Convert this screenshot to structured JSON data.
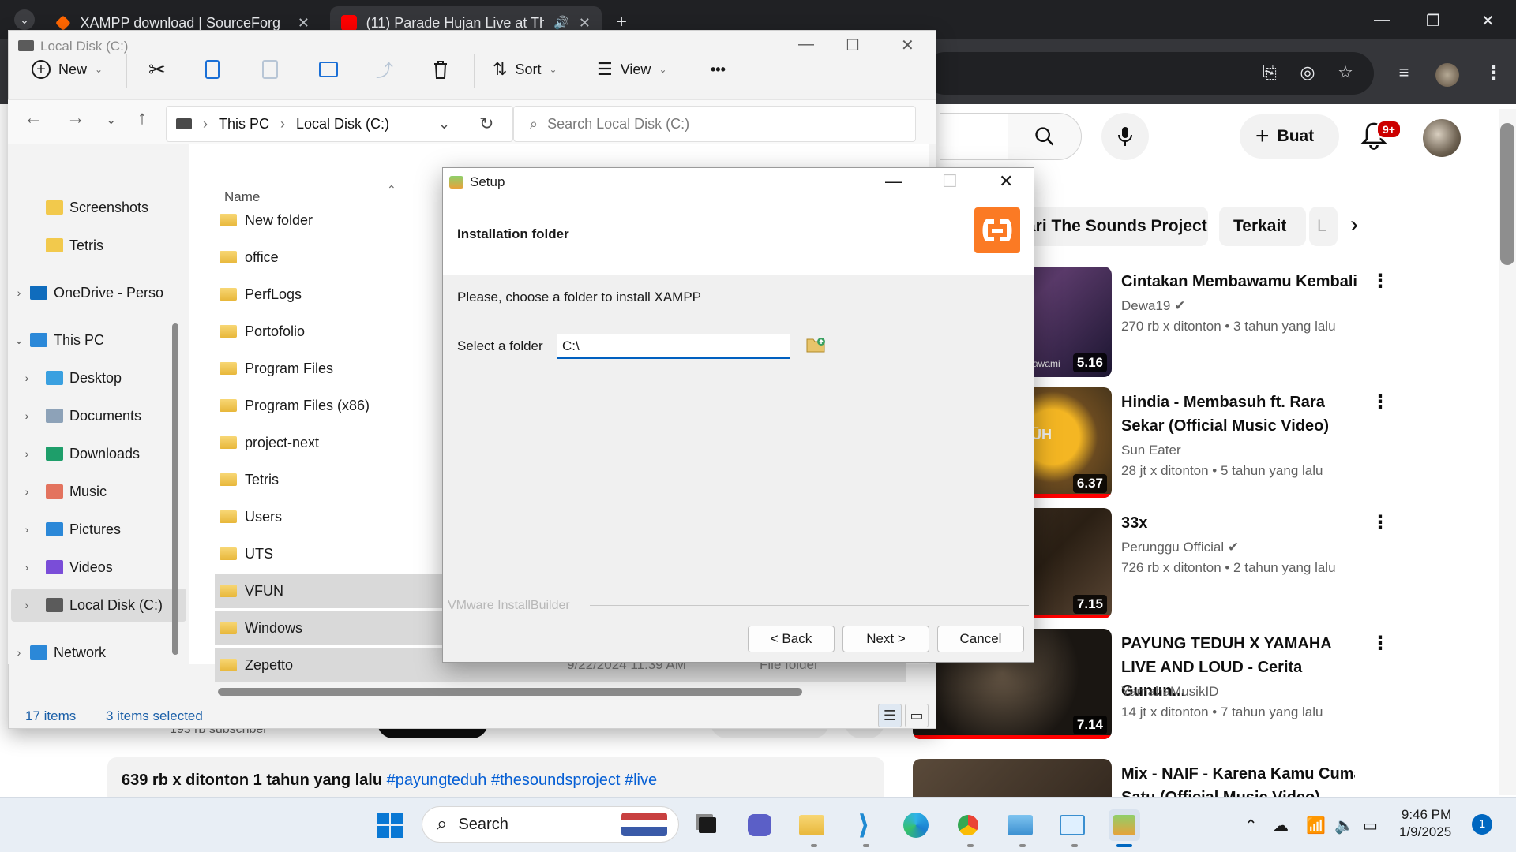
{
  "browser": {
    "tabs": [
      {
        "title": "XAMPP download | SourceForg",
        "favicon_color": "#ff6600"
      },
      {
        "title": "(11) Parade Hujan Live at Th",
        "favicon_color": "#ff0000"
      }
    ],
    "new_tab_symbol": "+",
    "window_controls": {
      "minimize": "—",
      "maximize": "❐",
      "close": "✕"
    }
  },
  "youtube": {
    "create_label": "Buat",
    "notification_count": "9+",
    "chips": [
      "ari The Sounds Project",
      "Terkait",
      "L"
    ],
    "videos": [
      {
        "title": "Cintakan Membawamu Kembali",
        "channel": "Dewa19",
        "verified": true,
        "meta": "270 rb x ditonton  • 3 tahun yang lalu",
        "duration": "5.16",
        "thumb_text": "awami"
      },
      {
        "title": "Hindia - Membasuh ft. Rara Sekar (Official Music Video)",
        "channel": "Sun Eater",
        "verified": false,
        "meta": "28 jt x ditonton  • 5 tahun yang lalu",
        "duration": "6.37",
        "thumb_text": "ŪH"
      },
      {
        "title": "33x",
        "channel": "Perunggu Official",
        "verified": true,
        "meta": "726 rb x ditonton  • 2 tahun yang lalu",
        "duration": "7.15",
        "thumb_text": ""
      },
      {
        "title": "PAYUNG TEDUH X YAMAHA LIVE AND LOUD - Cerita Gunun...",
        "channel": "YamahaMusikID",
        "verified": false,
        "meta": "14 jt x ditonton  • 7 tahun yang lalu",
        "duration": "7.14",
        "thumb_text": ""
      },
      {
        "title": "Mix - NAIF - Karena Kamu Cuma Satu (Official Music Video)",
        "channel": "",
        "verified": false,
        "meta": "",
        "duration": "",
        "thumb_text": ""
      }
    ],
    "subscriber_peek": "193 rb subscriber",
    "description": {
      "views": "639 rb x ditonton  1 tahun yang lalu",
      "tags": "#payungteduh #thesoundsproject #live"
    }
  },
  "explorer": {
    "title": "Local Disk (C:)",
    "commands": {
      "new": "New",
      "sort": "Sort",
      "view": "View",
      "more": "•••"
    },
    "breadcrumb": [
      "This PC",
      "Local Disk (C:)"
    ],
    "search_placeholder": "Search Local Disk (C:)",
    "column_name": "Name",
    "sidebar": [
      {
        "label": "Screenshots",
        "indent": 1,
        "chevron": "",
        "icon": "folder-icon",
        "color": "#f2c94c"
      },
      {
        "label": "Tetris",
        "indent": 1,
        "chevron": "",
        "icon": "folder-icon",
        "color": "#f2c94c"
      },
      {
        "label": "OneDrive - Perso",
        "indent": 0,
        "chevron": "›",
        "icon": "cloud-icon",
        "color": "#0f6cbd"
      },
      {
        "label": "This PC",
        "indent": 0,
        "chevron": "⌄",
        "icon": "monitor-icon",
        "color": "#2b88d8"
      },
      {
        "label": "Desktop",
        "indent": 1,
        "chevron": "›",
        "icon": "desktop-icon",
        "color": "#3aa0e0"
      },
      {
        "label": "Documents",
        "indent": 1,
        "chevron": "›",
        "icon": "documents-icon",
        "color": "#8da2b8"
      },
      {
        "label": "Downloads",
        "indent": 1,
        "chevron": "›",
        "icon": "download-icon",
        "color": "#1e9e6a"
      },
      {
        "label": "Music",
        "indent": 1,
        "chevron": "›",
        "icon": "music-icon",
        "color": "#e3735e"
      },
      {
        "label": "Pictures",
        "indent": 1,
        "chevron": "›",
        "icon": "pictures-icon",
        "color": "#2b88d8"
      },
      {
        "label": "Videos",
        "indent": 1,
        "chevron": "›",
        "icon": "videos-icon",
        "color": "#7a4dd8"
      },
      {
        "label": "Local Disk (C:)",
        "indent": 1,
        "chevron": "›",
        "icon": "drive-icon",
        "color": "#5b5b5b",
        "selected": true
      },
      {
        "label": "Network",
        "indent": 0,
        "chevron": "›",
        "icon": "network-icon",
        "color": "#2b88d8"
      }
    ],
    "files": [
      {
        "name": "New folder",
        "date": "",
        "type": "",
        "selected": false
      },
      {
        "name": "office",
        "date": "",
        "type": "",
        "selected": false
      },
      {
        "name": "PerfLogs",
        "date": "",
        "type": "",
        "selected": false
      },
      {
        "name": "Portofolio",
        "date": "",
        "type": "",
        "selected": false
      },
      {
        "name": "Program Files",
        "date": "",
        "type": "",
        "selected": false
      },
      {
        "name": "Program Files (x86)",
        "date": "",
        "type": "",
        "selected": false
      },
      {
        "name": "project-next",
        "date": "",
        "type": "",
        "selected": false
      },
      {
        "name": "Tetris",
        "date": "",
        "type": "",
        "selected": false
      },
      {
        "name": "Users",
        "date": "",
        "type": "",
        "selected": false
      },
      {
        "name": "UTS",
        "date": "",
        "type": "",
        "selected": false
      },
      {
        "name": "VFUN",
        "date": "",
        "type": "",
        "selected": true
      },
      {
        "name": "Windows",
        "date": "",
        "type": "",
        "selected": true
      },
      {
        "name": "Zepetto",
        "date": "9/22/2024 11:39 AM",
        "type": "File folder",
        "selected": true
      }
    ],
    "status_items": "17 items",
    "status_selected": "3 items selected"
  },
  "setup": {
    "title": "Setup",
    "heading": "Installation folder",
    "instruction": "Please, choose a folder to install XAMPP",
    "folder_label": "Select a folder",
    "folder_value": "C:\\",
    "brand": "VMware InstallBuilder",
    "buttons": {
      "back": "< Back",
      "next": "Next >",
      "cancel": "Cancel"
    },
    "logo_color": "#fb7a24"
  },
  "taskbar": {
    "search_label": "Search",
    "time": "9:46 PM",
    "date": "1/9/2025",
    "notification_count": "1"
  }
}
